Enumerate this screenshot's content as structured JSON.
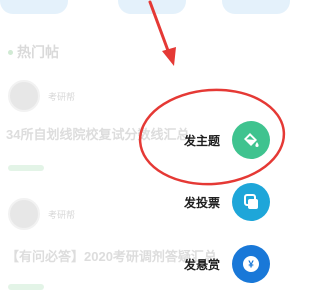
{
  "header_pills": [
    "",
    "",
    ""
  ],
  "section": {
    "title": "热门帖"
  },
  "posts": [
    {
      "author": "考研帮",
      "title": "34所自划线院校复试分数线汇总"
    },
    {
      "author": "考研帮",
      "title": "【有问必答】2020考研调剂答疑汇总"
    }
  ],
  "fab_menu": {
    "items": [
      {
        "label": "发主题",
        "icon": "paint-bucket-icon",
        "color": "#3fc38f"
      },
      {
        "label": "发投票",
        "icon": "copy-squares-icon",
        "color": "#1ea6d9"
      },
      {
        "label": "发悬赏",
        "icon": "yen-coin-icon",
        "color": "#1978d8"
      }
    ]
  },
  "annotation": {
    "arrow_color": "#e53935",
    "circle_color": "#e53935"
  }
}
